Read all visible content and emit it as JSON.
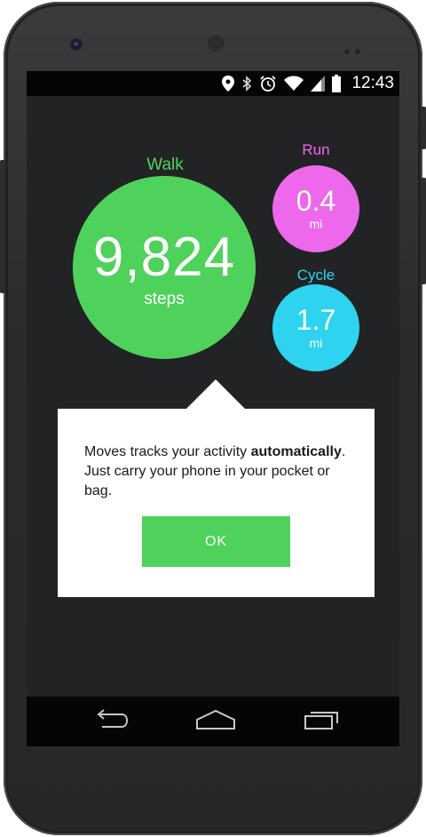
{
  "status_bar": {
    "time": "12:43",
    "icons": [
      "location-icon",
      "bluetooth-icon",
      "alarm-icon",
      "wifi-icon",
      "signal-icon",
      "battery-icon"
    ]
  },
  "activities": {
    "walk": {
      "label": "Walk",
      "value": "9,824",
      "unit": "steps",
      "color": "#4fd25b"
    },
    "run": {
      "label": "Run",
      "value": "0.4",
      "unit": "mi",
      "color": "#ee68ec"
    },
    "cycle": {
      "label": "Cycle",
      "value": "1.7",
      "unit": "mi",
      "color": "#2ed4ef"
    }
  },
  "dialog": {
    "text_part1": "Moves tracks your activity ",
    "text_bold": "automatically",
    "text_part2": ". Just carry your phone in your pocket or bag.",
    "ok_label": "OK"
  },
  "nav_bar": {
    "buttons": [
      "back-icon",
      "home-icon",
      "recents-icon"
    ]
  }
}
